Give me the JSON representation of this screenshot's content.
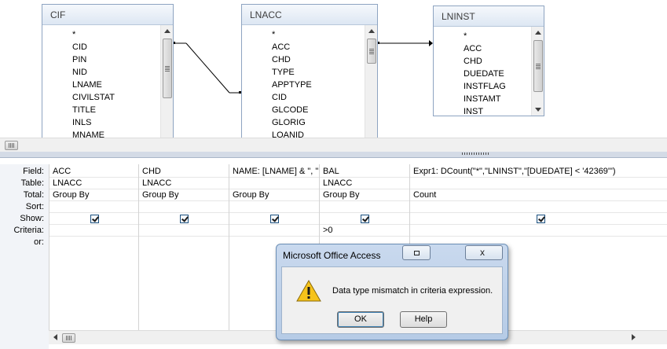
{
  "tables": [
    {
      "name": "CIF",
      "fields": [
        "*",
        "CID",
        "PIN",
        "NID",
        "LNAME",
        "CIVILSTAT",
        "TITLE",
        "INLS",
        "MNAME"
      ]
    },
    {
      "name": "LNACC",
      "fields": [
        "*",
        "ACC",
        "CHD",
        "TYPE",
        "APPTYPE",
        "CID",
        "GLCODE",
        "GLORIG",
        "LOANID"
      ]
    },
    {
      "name": "LNINST",
      "fields": [
        "*",
        "ACC",
        "CHD",
        "DUEDATE",
        "INSTFLAG",
        "INSTAMT",
        "INST"
      ]
    }
  ],
  "grid": {
    "row_labels": [
      "Field:",
      "Table:",
      "Total:",
      "Sort:",
      "Show:",
      "Criteria:",
      "or:"
    ],
    "columns": [
      {
        "field": "ACC",
        "table": "LNACC",
        "total": "Group By",
        "sort": "",
        "show": true,
        "criteria": "",
        "or": ""
      },
      {
        "field": "CHD",
        "table": "LNACC",
        "total": "Group By",
        "sort": "",
        "show": true,
        "criteria": "",
        "or": ""
      },
      {
        "field": "NAME: [LNAME] & \", \"",
        "table": "",
        "total": "Group By",
        "sort": "",
        "show": true,
        "criteria": "",
        "or": ""
      },
      {
        "field": "BAL",
        "table": "LNACC",
        "total": "Group By",
        "sort": "",
        "show": true,
        "criteria": ">0",
        "or": ""
      },
      {
        "field": "Expr1: DCount(\"*\",\"LNINST\",\"[DUEDATE] < '42369'\")",
        "table": "",
        "total": "Count",
        "sort": "",
        "show": true,
        "criteria": "",
        "or": ""
      }
    ]
  },
  "dialog": {
    "title": "Microsoft Office Access",
    "message": "Data type mismatch in criteria expression.",
    "ok_label": "OK",
    "help_label": "Help",
    "close_glyph": "x",
    "icon": "warning-icon"
  },
  "colors": {
    "dialog_frame": "#b6cbe6",
    "table_border": "#8ea4c1",
    "warning_yellow": "#f6c31b"
  }
}
